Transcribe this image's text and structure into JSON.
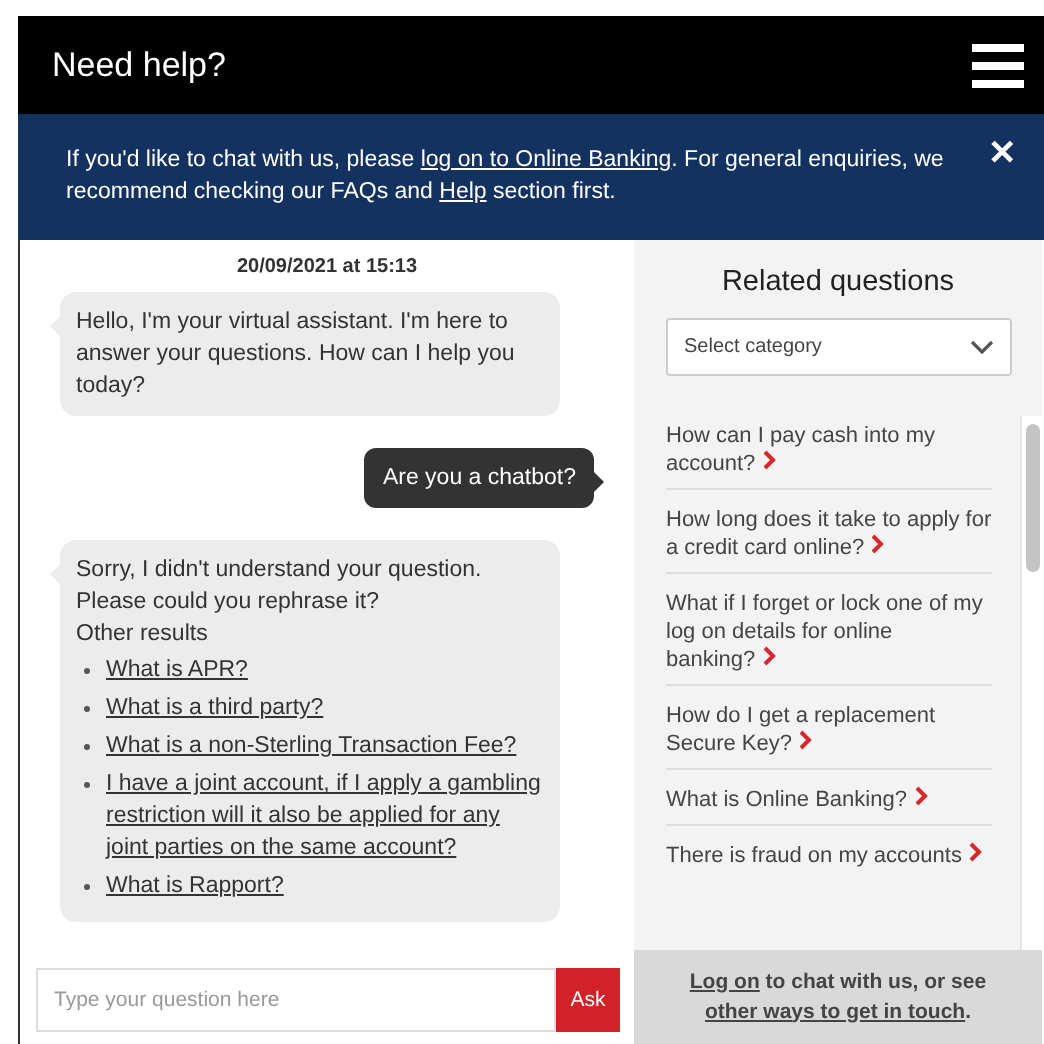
{
  "header": {
    "title": "Need help?"
  },
  "banner": {
    "segments": [
      {
        "kind": "text",
        "text": "If you'd like to chat with us, please "
      },
      {
        "kind": "link",
        "text": "log on to Online Banking"
      },
      {
        "kind": "text",
        "text": ". For general enquiries, we recommend checking our FAQs and "
      },
      {
        "kind": "link",
        "text": "Help"
      },
      {
        "kind": "text",
        "text": " section first."
      }
    ],
    "close": "✕"
  },
  "chat": {
    "timestamp": "20/09/2021 at 15:13",
    "messages": [
      {
        "kind": "bot",
        "lines": [
          "Hello, I'm your virtual assistant. I'm here to answer your questions. How can I help you today?"
        ]
      },
      {
        "kind": "user",
        "lines": [
          "Are you a chatbot?"
        ]
      },
      {
        "kind": "bot",
        "lines": [
          "Sorry, I didn't understand your question.",
          "Please could you rephrase it?",
          "Other results"
        ],
        "links": [
          "What is APR?",
          "What is a third party?",
          "What is a non-Sterling Transaction Fee?",
          "I have a joint account, if I apply a gambling restriction will it also be applied for any joint parties on the same account?",
          "What is Rapport?"
        ]
      }
    ],
    "input": {
      "placeholder": "Type your question here",
      "button": "Ask"
    }
  },
  "related": {
    "title": "Related questions",
    "select": {
      "placeholder": "Select category"
    },
    "questions": [
      "How can I pay cash into my account?",
      "How long does it take to apply for a credit card online?",
      "What if I forget or lock one of my log on details for online banking?",
      "How do I get a replacement Secure Key?",
      "What is Online Banking?",
      "There is fraud on my accounts"
    ],
    "footer": [
      {
        "kind": "link",
        "text": "Log on"
      },
      {
        "kind": "text",
        "text": " to chat with us, or see "
      },
      {
        "kind": "link",
        "text": "other ways to get in touch"
      },
      {
        "kind": "text",
        "text": "."
      }
    ]
  }
}
